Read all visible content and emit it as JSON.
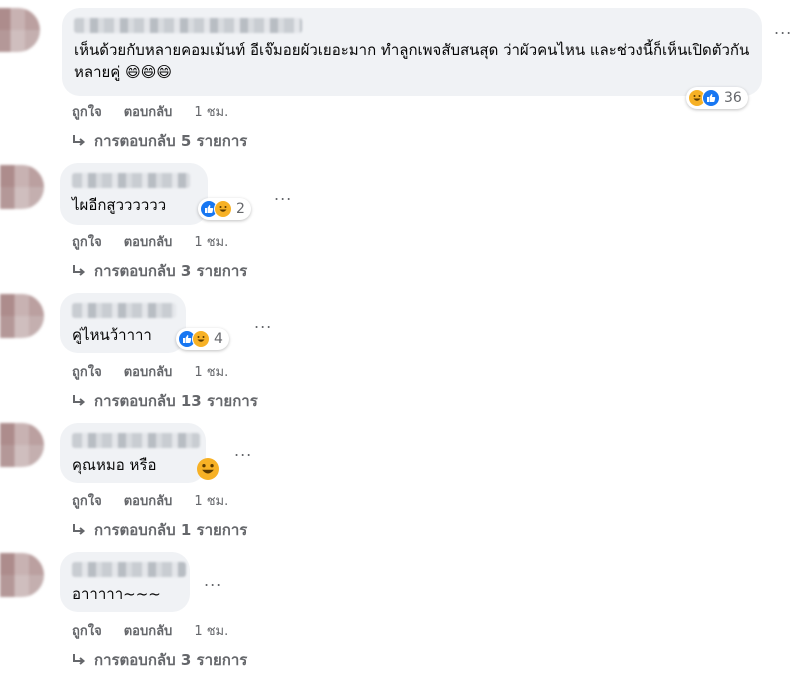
{
  "comments": [
    {
      "text": "เห็นด้วยกับหลายคอมเม้นท์ อีเจ๊มอยผัวเยอะมาก ทำลูกเพจสับสนสุด ว่าผัวคนไหน และช่วงนี้ก็เห็นเปิดตัวกันหลายคู่ 😄😄😄",
      "reaction_count": "36",
      "like_label": "ถูกใจ",
      "reply_label": "ตอบกลับ",
      "time": "1 ชม.",
      "replies_text": "การตอบกลับ 5 รายการ",
      "more": "..."
    },
    {
      "text": "ไผอีกสูวววววว",
      "reaction_count": "2",
      "like_label": "ถูกใจ",
      "reply_label": "ตอบกลับ",
      "time": "1 ชม.",
      "replies_text": "การตอบกลับ 3 รายการ",
      "more": "..."
    },
    {
      "text": "คู่ไหนว้าาาา",
      "reaction_count": "4",
      "like_label": "ถูกใจ",
      "reply_label": "ตอบกลับ",
      "time": "1 ชม.",
      "replies_text": "การตอบกลับ 13 รายการ",
      "more": "..."
    },
    {
      "text": "คุณหมอ หรือ",
      "reaction_count": "",
      "like_label": "ถูกใจ",
      "reply_label": "ตอบกลับ",
      "time": "1 ชม.",
      "replies_text": "การตอบกลับ 1 รายการ",
      "more": "..."
    },
    {
      "text": "อาาาาา~~~",
      "reaction_count": "",
      "like_label": "ถูกใจ",
      "reply_label": "ตอบกลับ",
      "time": "1 ชม.",
      "replies_text": "การตอบกลับ 3 รายการ",
      "more": "..."
    }
  ],
  "colors": {
    "bubble": "#f0f2f5",
    "meta": "#65676b",
    "like": "#1877f2",
    "haha": "#f7b125"
  },
  "icons": [
    "like-icon",
    "haha-icon",
    "reply-arrow-icon",
    "more-icon"
  ]
}
